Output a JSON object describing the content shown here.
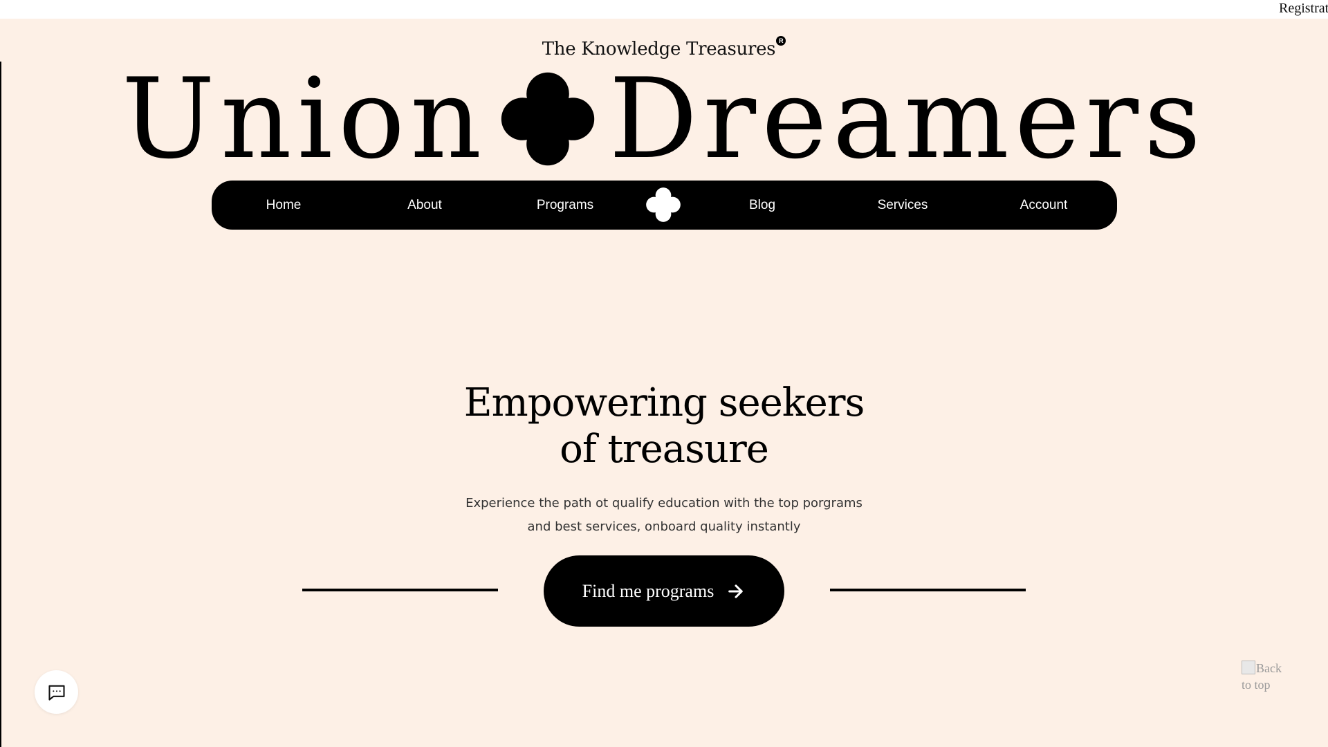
{
  "topbar": {
    "registration_text": "Registrat"
  },
  "brand": {
    "tagline": "The Knowledge Treasures",
    "registered_mark": "R",
    "logo_word_1": "Union",
    "logo_word_2": "Dreamers"
  },
  "nav": {
    "items": [
      {
        "label": "Home"
      },
      {
        "label": "About"
      },
      {
        "label": "Programs"
      },
      {
        "label": "Blog"
      },
      {
        "label": "Services"
      },
      {
        "label": "Account"
      }
    ]
  },
  "hero": {
    "title_line_1": "Empowering seekers",
    "title_line_2": "of treasure",
    "subtitle_line_1": "Experience the path ot qualify education with the top porgrams",
    "subtitle_line_2": "and best services, onboard quality instantly",
    "cta_label": "Find me programs"
  },
  "widgets": {
    "back_to_top_line_1": "Back",
    "back_to_top_line_2": "to top"
  },
  "colors": {
    "background": "#fdf0e6",
    "primary": "#000000",
    "on_primary": "#ffffff"
  },
  "icons": {
    "logo_mark": "flower-icon",
    "nav_mark": "flower-icon",
    "cta": "arrow-right-icon",
    "chat": "chat-bubble-icon",
    "back_to_top": "broken-image-icon"
  }
}
